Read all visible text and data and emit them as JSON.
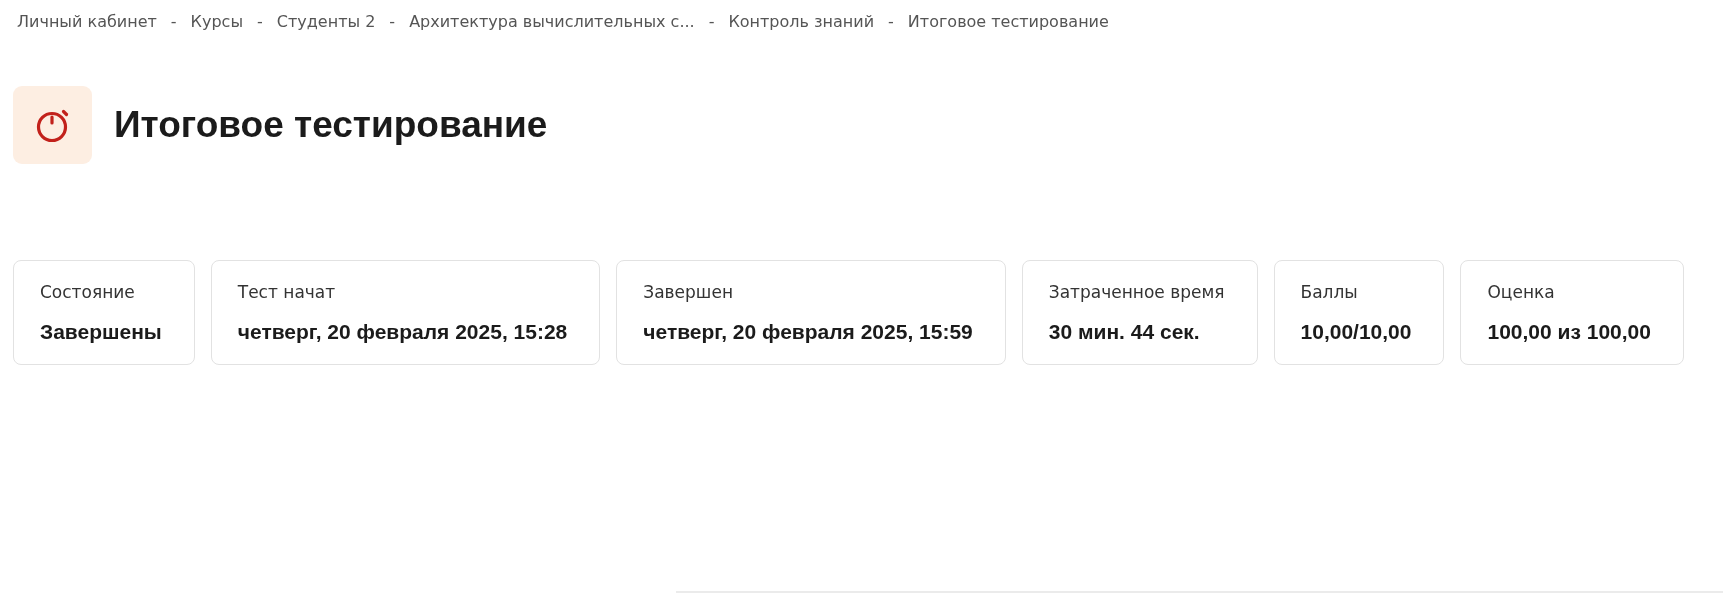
{
  "breadcrumb": {
    "separator": "-",
    "items": [
      "Личный кабинет",
      "Курсы",
      "Студенты 2",
      "Архитектура вычислительных с...",
      "Контроль знаний",
      "Итоговое тестирование"
    ]
  },
  "header": {
    "title": "Итоговое тестирование"
  },
  "summary": [
    {
      "label": "Состояние",
      "value": "Завершены"
    },
    {
      "label": "Тест начат",
      "value": "четверг, 20 февраля 2025, 15:28"
    },
    {
      "label": "Завершен",
      "value": "четверг, 20 февраля 2025, 15:59"
    },
    {
      "label": "Затраченное время",
      "value": "30 мин. 44 сек."
    },
    {
      "label": "Баллы",
      "value": "10,00/10,00"
    },
    {
      "label": "Оценка",
      "value": "100,00 из 100,00"
    }
  ]
}
